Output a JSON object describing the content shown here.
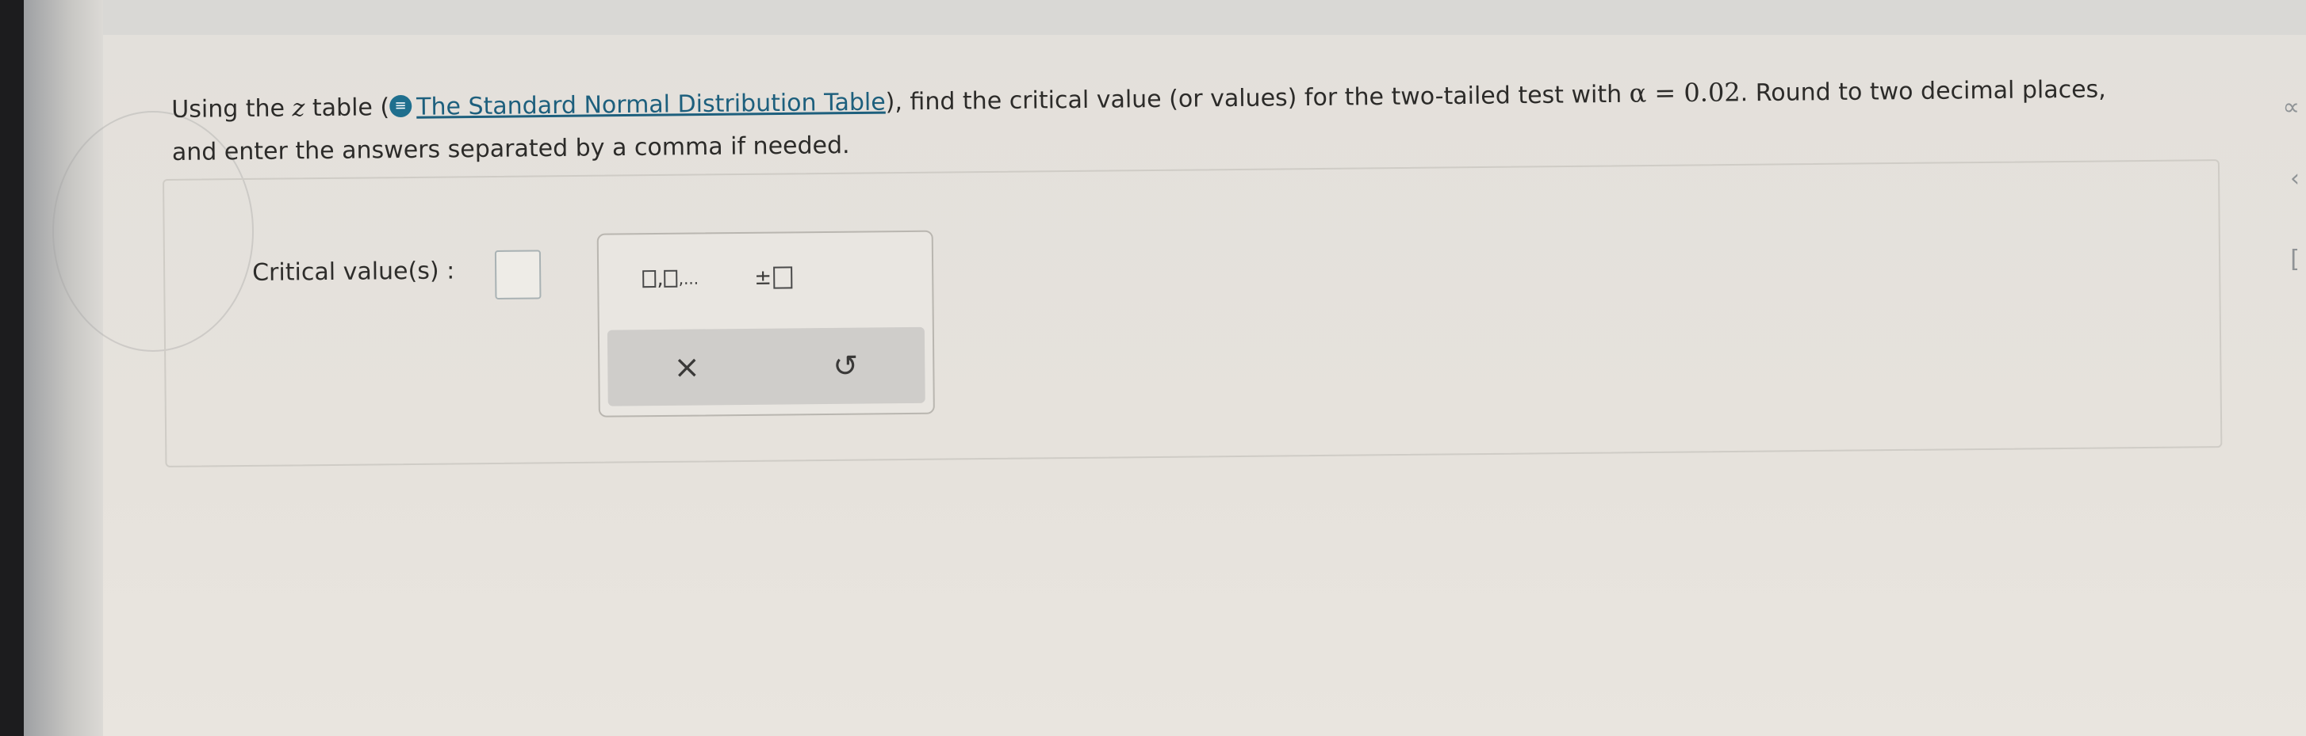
{
  "question": {
    "part1": "Using the ",
    "z": "z",
    "part2": " table (",
    "link_icon": "≡",
    "link_text": "The Standard Normal Distribution Table",
    "part3": "), find the critical value (or values) for the two-tailed test with ",
    "alpha_expr": "α = 0.02",
    "part4": ". Round to two decimal places, and enter the answers separated by a comma if needed."
  },
  "answer": {
    "label": "Critical value(s) :",
    "input_value": ""
  },
  "keypad": {
    "list_suffix": ",...",
    "plusminus": "±",
    "clear_symbol": "×",
    "undo_symbol": "↺"
  },
  "right_edge": {
    "glyph1": "∝",
    "glyph2": "‹",
    "glyph3": "["
  },
  "icons": {
    "info": "info-table-icon",
    "clear": "close-icon",
    "undo": "undo-icon"
  },
  "colors": {
    "link": "#1d5f7d",
    "icon_bg": "#1f6f8e"
  }
}
